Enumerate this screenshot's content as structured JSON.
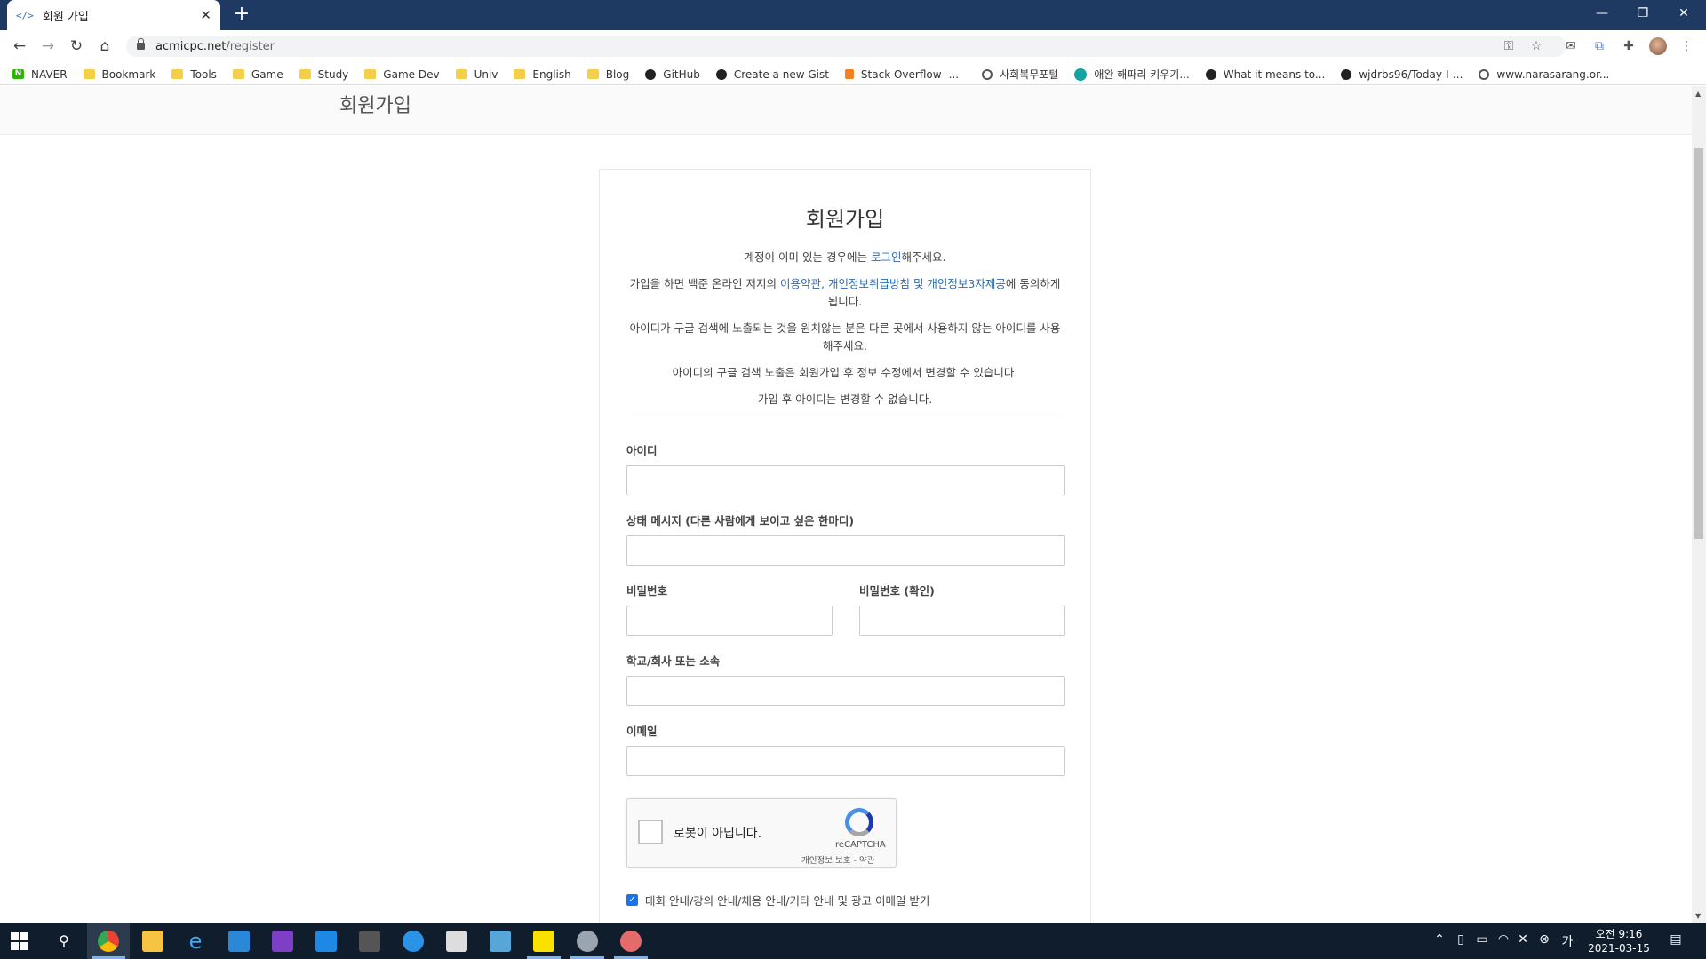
{
  "browser": {
    "tab_title": "회원 가입",
    "tab_favicon": "</>",
    "url_host": "acmicpc.net",
    "url_path": "/register",
    "new_tab_label": "+"
  },
  "bookmarks": [
    {
      "label": "NAVER",
      "icon": "naver-icon"
    },
    {
      "label": "Bookmark",
      "icon": "folder-icon"
    },
    {
      "label": "Tools",
      "icon": "folder-icon"
    },
    {
      "label": "Game",
      "icon": "folder-icon"
    },
    {
      "label": "Study",
      "icon": "folder-icon"
    },
    {
      "label": "Game Dev",
      "icon": "folder-icon"
    },
    {
      "label": "Univ",
      "icon": "folder-icon"
    },
    {
      "label": "English",
      "icon": "folder-icon"
    },
    {
      "label": "Blog",
      "icon": "folder-icon"
    },
    {
      "label": "GitHub",
      "icon": "github-icon"
    },
    {
      "label": "Create a new Gist",
      "icon": "github-icon"
    },
    {
      "label": "Stack Overflow -...",
      "icon": "stackoverflow-icon"
    },
    {
      "label": "사회복무포털",
      "icon": "globe-icon"
    },
    {
      "label": "애완 해파리 키우기...",
      "icon": "wordpress-icon"
    },
    {
      "label": "What it means to...",
      "icon": "github-icon"
    },
    {
      "label": "wjdrbs96/Today-I-...",
      "icon": "github-icon"
    },
    {
      "label": "www.narasarang.or...",
      "icon": "globe-icon"
    }
  ],
  "page": {
    "header_title": "회원가입",
    "card_title": "회원가입",
    "note1_pre": "계정이 이미 있는 경우에는 ",
    "note1_link": "로그인",
    "note1_post": "해주세요.",
    "note2_pre": "가입을 하면 백준 온라인 저지의 ",
    "note2_link1": "이용약관",
    "note2_sep1": ", ",
    "note2_link2": "개인정보취급방침",
    "note2_sep2": " 및 ",
    "note2_link3": "개인정보3자제공",
    "note2_post": "에 동의하게 됩니다.",
    "note3": "아이디가 구글 검색에 노출되는 것을 원치않는 분은 다른 곳에서 사용하지 않는 아이디를 사용해주세요.",
    "note4": "아이디의 구글 검색 노출은 회원가입 후 정보 수정에서 변경할 수 있습니다.",
    "note5": "가입 후 아이디는 변경할 수 없습니다."
  },
  "form": {
    "id_label": "아이디",
    "status_label": "상태 메시지 (다른 사람에게 보이고 싶은 한마디)",
    "password_label": "비밀번호",
    "password_confirm_label": "비밀번호 (확인)",
    "school_label": "학교/회사 또는 소속",
    "email_label": "이메일",
    "captcha_text": "로봇이 아닙니다.",
    "captcha_brand": "reCAPTCHA",
    "captcha_terms": "개인정보 보호 - 약관",
    "agree_label": "대회 안내/강의 안내/채용 안내/기타 안내 및 광고 이메일 받기",
    "agree_checked": true
  },
  "taskbar": {
    "clock_time": "오전 9:16",
    "clock_date": "2021-03-15"
  },
  "colors": {
    "tabbar": "#1e3a63",
    "link": "#2a6bb5",
    "taskbar": "#101d2c"
  }
}
